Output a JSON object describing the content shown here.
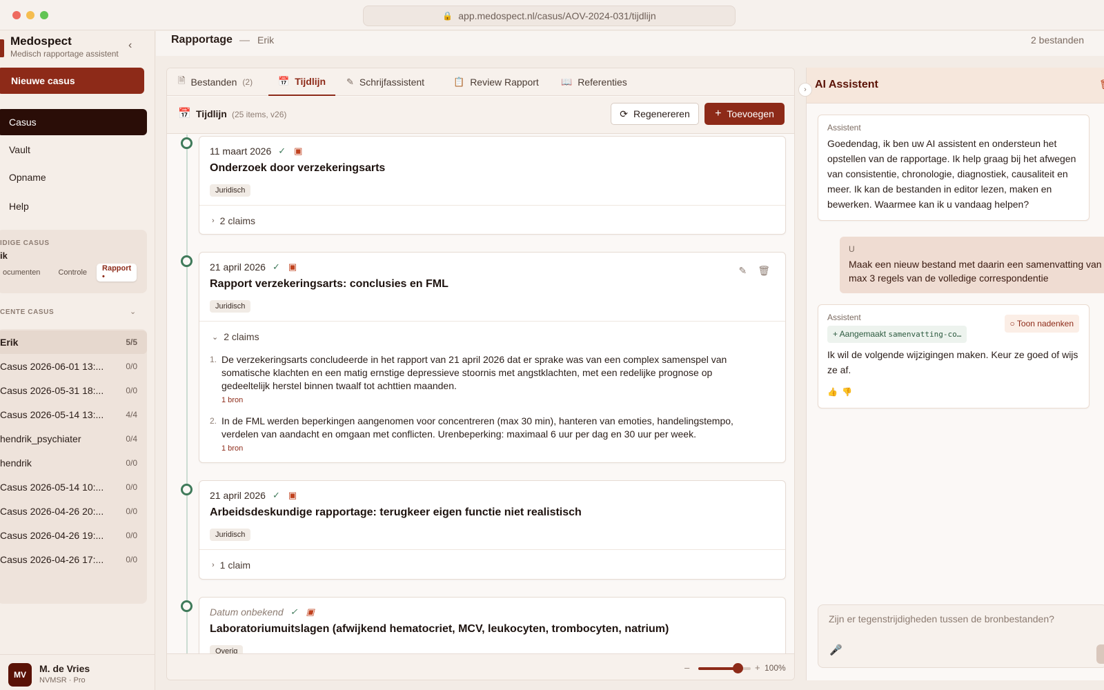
{
  "browser": {
    "url": "app.medospect.nl/casus/AOV-2024-031/tijdlijn"
  },
  "app": {
    "name": "Medospect",
    "subtitle": "Medisch rapportage assistent"
  },
  "sidebar": {
    "new_case": "Nieuwe casus",
    "nav": [
      {
        "label": "Casus"
      },
      {
        "label": "Vault"
      },
      {
        "label": "Opname"
      },
      {
        "label": "Help"
      }
    ],
    "current_case_label": "IDIGE CASUS",
    "current_case_name": "ik",
    "current_tabs": [
      "ocumenten",
      "Controle",
      "Rapport •"
    ],
    "recent_label": "CENTE CASUS",
    "recent": [
      {
        "name": "Erik",
        "count": "5/5"
      },
      {
        "name": "Casus 2026-06-01 13:...",
        "count": "0/0"
      },
      {
        "name": "Casus 2026-05-31 18:...",
        "count": "0/0"
      },
      {
        "name": "Casus 2026-05-14 13:...",
        "count": "4/4"
      },
      {
        "name": "hendrik_psychiater",
        "count": "0/4"
      },
      {
        "name": "hendrik",
        "count": "0/0"
      },
      {
        "name": "Casus 2026-05-14 10:...",
        "count": "0/0"
      },
      {
        "name": "Casus 2026-04-26 20:...",
        "count": "0/0"
      },
      {
        "name": "Casus 2026-04-26 19:...",
        "count": "0/0"
      },
      {
        "name": "Casus 2026-04-26 17:...",
        "count": "0/0"
      }
    ],
    "user": {
      "initials": "MV",
      "name": "M. de Vries",
      "role": "NVMSR · Pro"
    }
  },
  "header": {
    "title": "Rapportage",
    "separator": "—",
    "case": "Erik",
    "files": "2 bestanden"
  },
  "tabs": [
    {
      "label": "Bestanden",
      "count": "(2)"
    },
    {
      "label": "Tijdlijn",
      "count": ""
    },
    {
      "label": "Schrijfassistent",
      "count": ""
    },
    {
      "label": "Review Rapport",
      "count": ""
    },
    {
      "label": "Referenties",
      "count": ""
    }
  ],
  "timeline": {
    "title": "Tijdlijn",
    "meta": "(25 items, v26)",
    "regen_label": "Regenereren",
    "add_label": "Toevoegen",
    "events": [
      {
        "date": "11 maart 2026",
        "title": "Onderzoek door verzekeringsarts",
        "tag": "Juridisch",
        "claims_label": "2 claims"
      },
      {
        "date": "21 april 2026",
        "title": "Rapport verzekeringsarts: conclusies en FML",
        "tag": "Juridisch",
        "claims_label": "2 claims",
        "claims": [
          {
            "num": "1.",
            "text": "De verzekeringsarts concludeerde in het rapport van 21 april 2026 dat er sprake was van een complex samenspel van somatische klachten en een matig ernstige depressieve stoornis met angstklachten, met een redelijke prognose op gedeeltelijk herstel binnen twaalf tot achttien maanden.",
            "source": "1 bron"
          },
          {
            "num": "2.",
            "text": "In de FML werden beperkingen aangenomen voor concentreren (max 30 min), hanteren van emoties, handelingstempo, verdelen van aandacht en omgaan met conflicten. Urenbeperking: maximaal 6 uur per dag en 30 uur per week.",
            "source": "1 bron"
          }
        ]
      },
      {
        "date": "21 april 2026",
        "title": "Arbeidsdeskundige rapportage: terugkeer eigen functie niet realistisch",
        "tag": "Juridisch",
        "claims_label": "1 claim"
      },
      {
        "date": "Datum onbekend",
        "title": "Laboratoriumuitslagen (afwijkend hematocriet, MCV, leukocyten, trombocyten, natrium)",
        "tag": "Overig"
      }
    ]
  },
  "zoom": {
    "value": "100%",
    "level": 0.75
  },
  "ai": {
    "title": "AI Assistent",
    "messages": [
      {
        "who": "Assistent",
        "text": "Goedendag, ik ben uw AI assistent en ondersteun het opstellen van de rapportage. Ik help graag bij het afwegen van consistentie, chronologie, diagnostiek, causaliteit en meer. Ik kan de bestanden in editor lezen, maken en bewerken. Waarmee kan ik u vandaag helpen?"
      },
      {
        "who": "U",
        "text": "Maak een nieuw bestand met daarin een samenvatting van max 3 regels van de volledige correspondentie"
      },
      {
        "who": "Assistent",
        "think": "Toon nadenken",
        "created_prefix": "+ Aangemaakt",
        "created_file": "samenvatting-co…",
        "text": "Ik wil de volgende wijzigingen maken. Keur ze goed of wijs ze af."
      }
    ],
    "input_placeholder": "Zijn er tegenstrijdigheden tussen de bronbestanden?"
  },
  "colors": {
    "brand": "#8d2a18",
    "nav_active": "#2a0d07",
    "timeline_dot": "#3f7a5a"
  }
}
